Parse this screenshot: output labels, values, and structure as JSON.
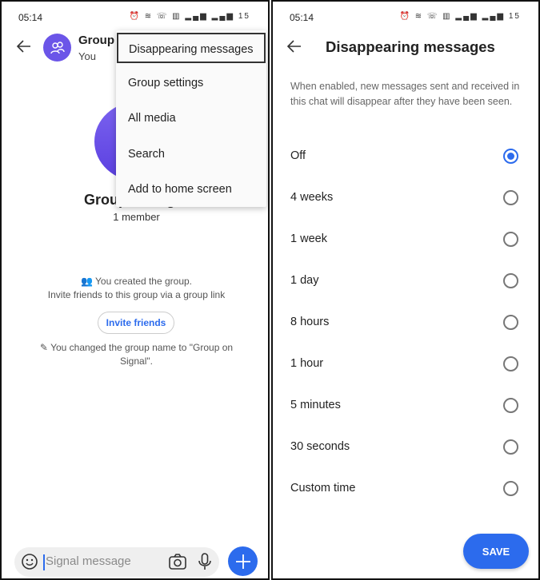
{
  "status": {
    "time": "05:14",
    "icons": "⏰ ≋ ☏ ▥ ▂▄▆ ▂▄▆ 15"
  },
  "left": {
    "header": {
      "title": "Group on Signal",
      "subtitle": "You"
    },
    "group_name": "Group on Signal",
    "member_count": "1 member",
    "menu": [
      "Disappearing messages",
      "Group settings",
      "All media",
      "Search",
      "Add to home screen"
    ],
    "events": {
      "created": "You created the group.",
      "invite_hint": "Invite friends to this group via a group link",
      "invite_button": "Invite friends",
      "renamed": "You changed the group name to \"Group on Signal\"."
    },
    "composer": {
      "placeholder": "Signal message"
    }
  },
  "right": {
    "title": "Disappearing messages",
    "description": "When enabled, new messages sent and received in this chat will disappear after they have been seen.",
    "options": [
      {
        "label": "Off",
        "selected": true
      },
      {
        "label": "4 weeks"
      },
      {
        "label": "1 week"
      },
      {
        "label": "1 day"
      },
      {
        "label": "8 hours"
      },
      {
        "label": "1 hour"
      },
      {
        "label": "5 minutes"
      },
      {
        "label": "30 seconds"
      },
      {
        "label": "Custom time"
      }
    ],
    "save_label": "SAVE"
  },
  "colors": {
    "accent": "#2c6bed",
    "avatar": "#6b55e8"
  }
}
